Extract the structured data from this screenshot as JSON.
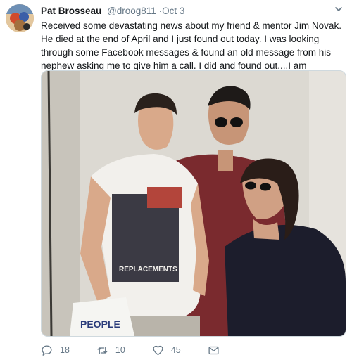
{
  "tweet": {
    "display_name": "Pat Brosseau",
    "handle": "@droog811",
    "separator": "·",
    "time": "Oct 3",
    "text": "Received some devastating news about my friend & mentor Jim Novak. He died at the end of April and I just found out today. I was looking through some Facebook messages & found an old message from his nephew asking me to give him a call. I did and found out....I am crushed.",
    "photo_shirt_text": "REPLACEMENTS",
    "photo_bag_text": "PEOPLE",
    "replies": "18",
    "retweets": "10",
    "likes": "45"
  },
  "icons": {
    "reply": "reply-icon",
    "retweet": "retweet-icon",
    "like": "heart-icon",
    "message": "envelope-icon",
    "menu": "chevron-down-icon"
  },
  "colors": {
    "icon_gray": "#657786",
    "text": "#14171a"
  }
}
